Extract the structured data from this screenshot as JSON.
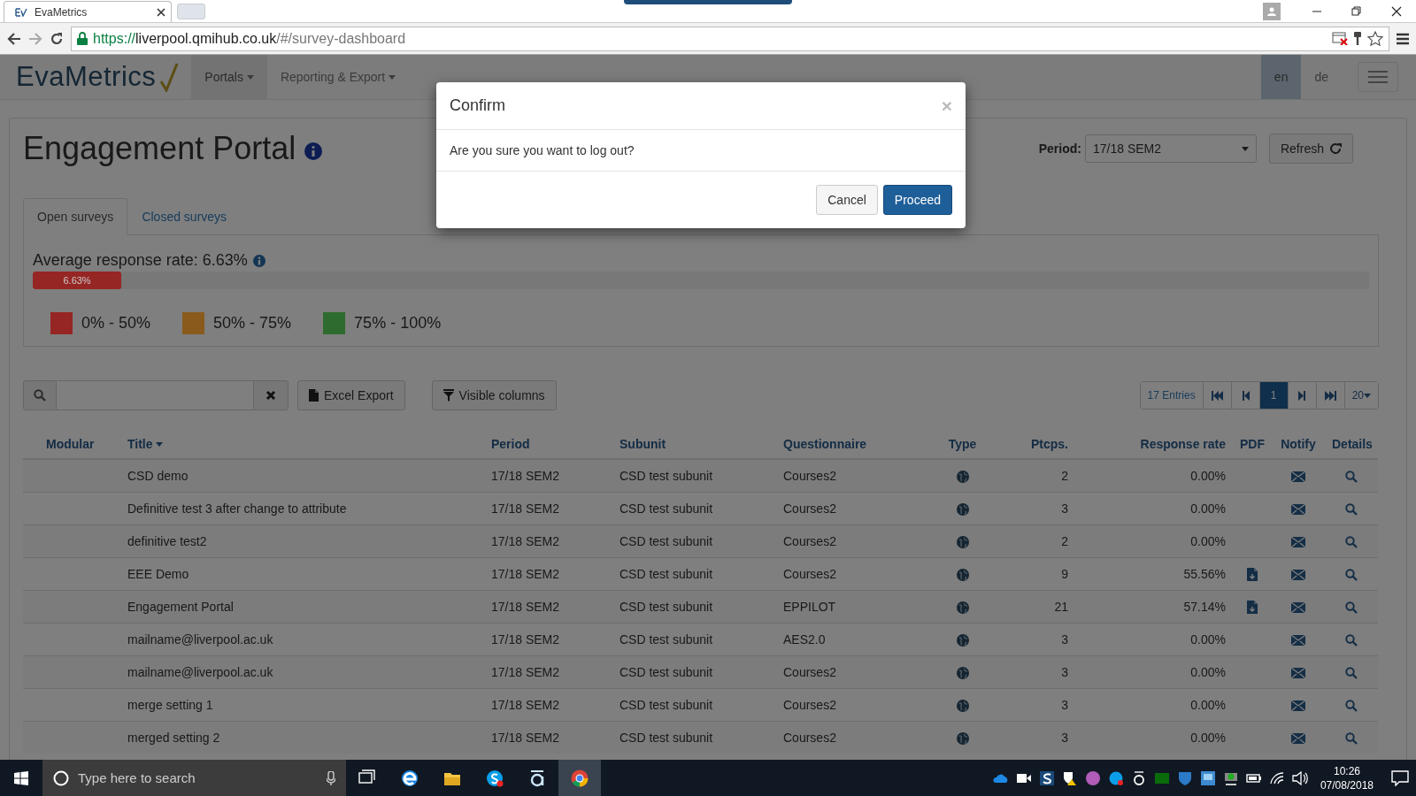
{
  "browser": {
    "tab_title": "EvaMetrics",
    "url_scheme": "https://",
    "url_host": "liverpool.qmihub.co.uk",
    "url_path": "/#/survey-dashboard"
  },
  "navbar": {
    "brand": "EvaMetrics",
    "items": [
      {
        "label": "Portals",
        "selected": true
      },
      {
        "label": "Reporting & Export",
        "selected": false
      }
    ],
    "languages": [
      {
        "label": "en",
        "selected": true
      },
      {
        "label": "de",
        "selected": false
      }
    ]
  },
  "header": {
    "title": "Engagement Portal",
    "period_label": "Period:",
    "period_value": "17/18 SEM2",
    "refresh": "Refresh"
  },
  "tabs": [
    {
      "label": "Open surveys",
      "selected": true
    },
    {
      "label": "Closed surveys",
      "selected": false
    }
  ],
  "summary": {
    "label": "Average response rate: 6.63%",
    "bar": {
      "level": 0.0663,
      "reading": "6.63%",
      "color": "#962624"
    },
    "legend": [
      {
        "label": "0% - 50%",
        "color": "#962624"
      },
      {
        "label": "50% - 75%",
        "color": "#8a5a1c"
      },
      {
        "label": "75% - 100%",
        "color": "#2e6b2e"
      }
    ]
  },
  "toolbar": {
    "excel_export": "Excel Export",
    "visible_columns": "Visible columns"
  },
  "pagination": {
    "entries": "17 Entries",
    "pages": [
      {
        "label": "1",
        "selected": true
      }
    ],
    "page_size": "20"
  },
  "table": {
    "columns": [
      {
        "label": "Modular",
        "sorted": false
      },
      {
        "label": "Title",
        "sorted": true
      },
      {
        "label": "Period",
        "sorted": false
      },
      {
        "label": "Subunit",
        "sorted": false
      },
      {
        "label": "Questionnaire",
        "sorted": false
      },
      {
        "label": "Type",
        "sorted": false
      },
      {
        "label": "Ptcps.",
        "sorted": false
      },
      {
        "label": "Response rate",
        "sorted": false
      },
      {
        "label": "PDF",
        "sorted": false
      },
      {
        "label": "Notify",
        "sorted": false
      },
      {
        "label": "Details",
        "sorted": false
      }
    ],
    "rows": [
      {
        "title": "CSD demo",
        "period": "17/18 SEM2",
        "subunit": "CSD test subunit",
        "questionnaire": "Courses2",
        "ptcps": "2",
        "rate": "0.00%",
        "pdf": false
      },
      {
        "title": "Definitive test 3 after change to attribute",
        "period": "17/18 SEM2",
        "subunit": "CSD test subunit",
        "questionnaire": "Courses2",
        "ptcps": "3",
        "rate": "0.00%",
        "pdf": false
      },
      {
        "title": "definitive test2",
        "period": "17/18 SEM2",
        "subunit": "CSD test subunit",
        "questionnaire": "Courses2",
        "ptcps": "2",
        "rate": "0.00%",
        "pdf": false
      },
      {
        "title": "EEE Demo",
        "period": "17/18 SEM2",
        "subunit": "CSD test subunit",
        "questionnaire": "Courses2",
        "ptcps": "9",
        "rate": "55.56%",
        "pdf": true
      },
      {
        "title": "Engagement Portal",
        "period": "17/18 SEM2",
        "subunit": "CSD test subunit",
        "questionnaire": "EPPILOT",
        "ptcps": "21",
        "rate": "57.14%",
        "pdf": true
      },
      {
        "title": "mailname@liverpool.ac.uk",
        "period": "17/18 SEM2",
        "subunit": "CSD test subunit",
        "questionnaire": "AES2.0",
        "ptcps": "3",
        "rate": "0.00%",
        "pdf": false
      },
      {
        "title": "mailname@liverpool.ac.uk",
        "period": "17/18 SEM2",
        "subunit": "CSD test subunit",
        "questionnaire": "Courses2",
        "ptcps": "3",
        "rate": "0.00%",
        "pdf": false
      },
      {
        "title": "merge setting 1",
        "period": "17/18 SEM2",
        "subunit": "CSD test subunit",
        "questionnaire": "Courses2",
        "ptcps": "3",
        "rate": "0.00%",
        "pdf": false
      },
      {
        "title": "merged setting 2",
        "period": "17/18 SEM2",
        "subunit": "CSD test subunit",
        "questionnaire": "Courses2",
        "ptcps": "3",
        "rate": "0.00%",
        "pdf": false
      }
    ]
  },
  "modal": {
    "title": "Confirm",
    "close": "×",
    "message": "Are you sure you want to log out?",
    "buttons": [
      {
        "label": "Cancel",
        "kind": "default"
      },
      {
        "label": "Proceed",
        "kind": "primary"
      }
    ]
  },
  "taskbar": {
    "search_placeholder": "Type here to search",
    "time": "10:26",
    "date": "07/08/2018"
  }
}
